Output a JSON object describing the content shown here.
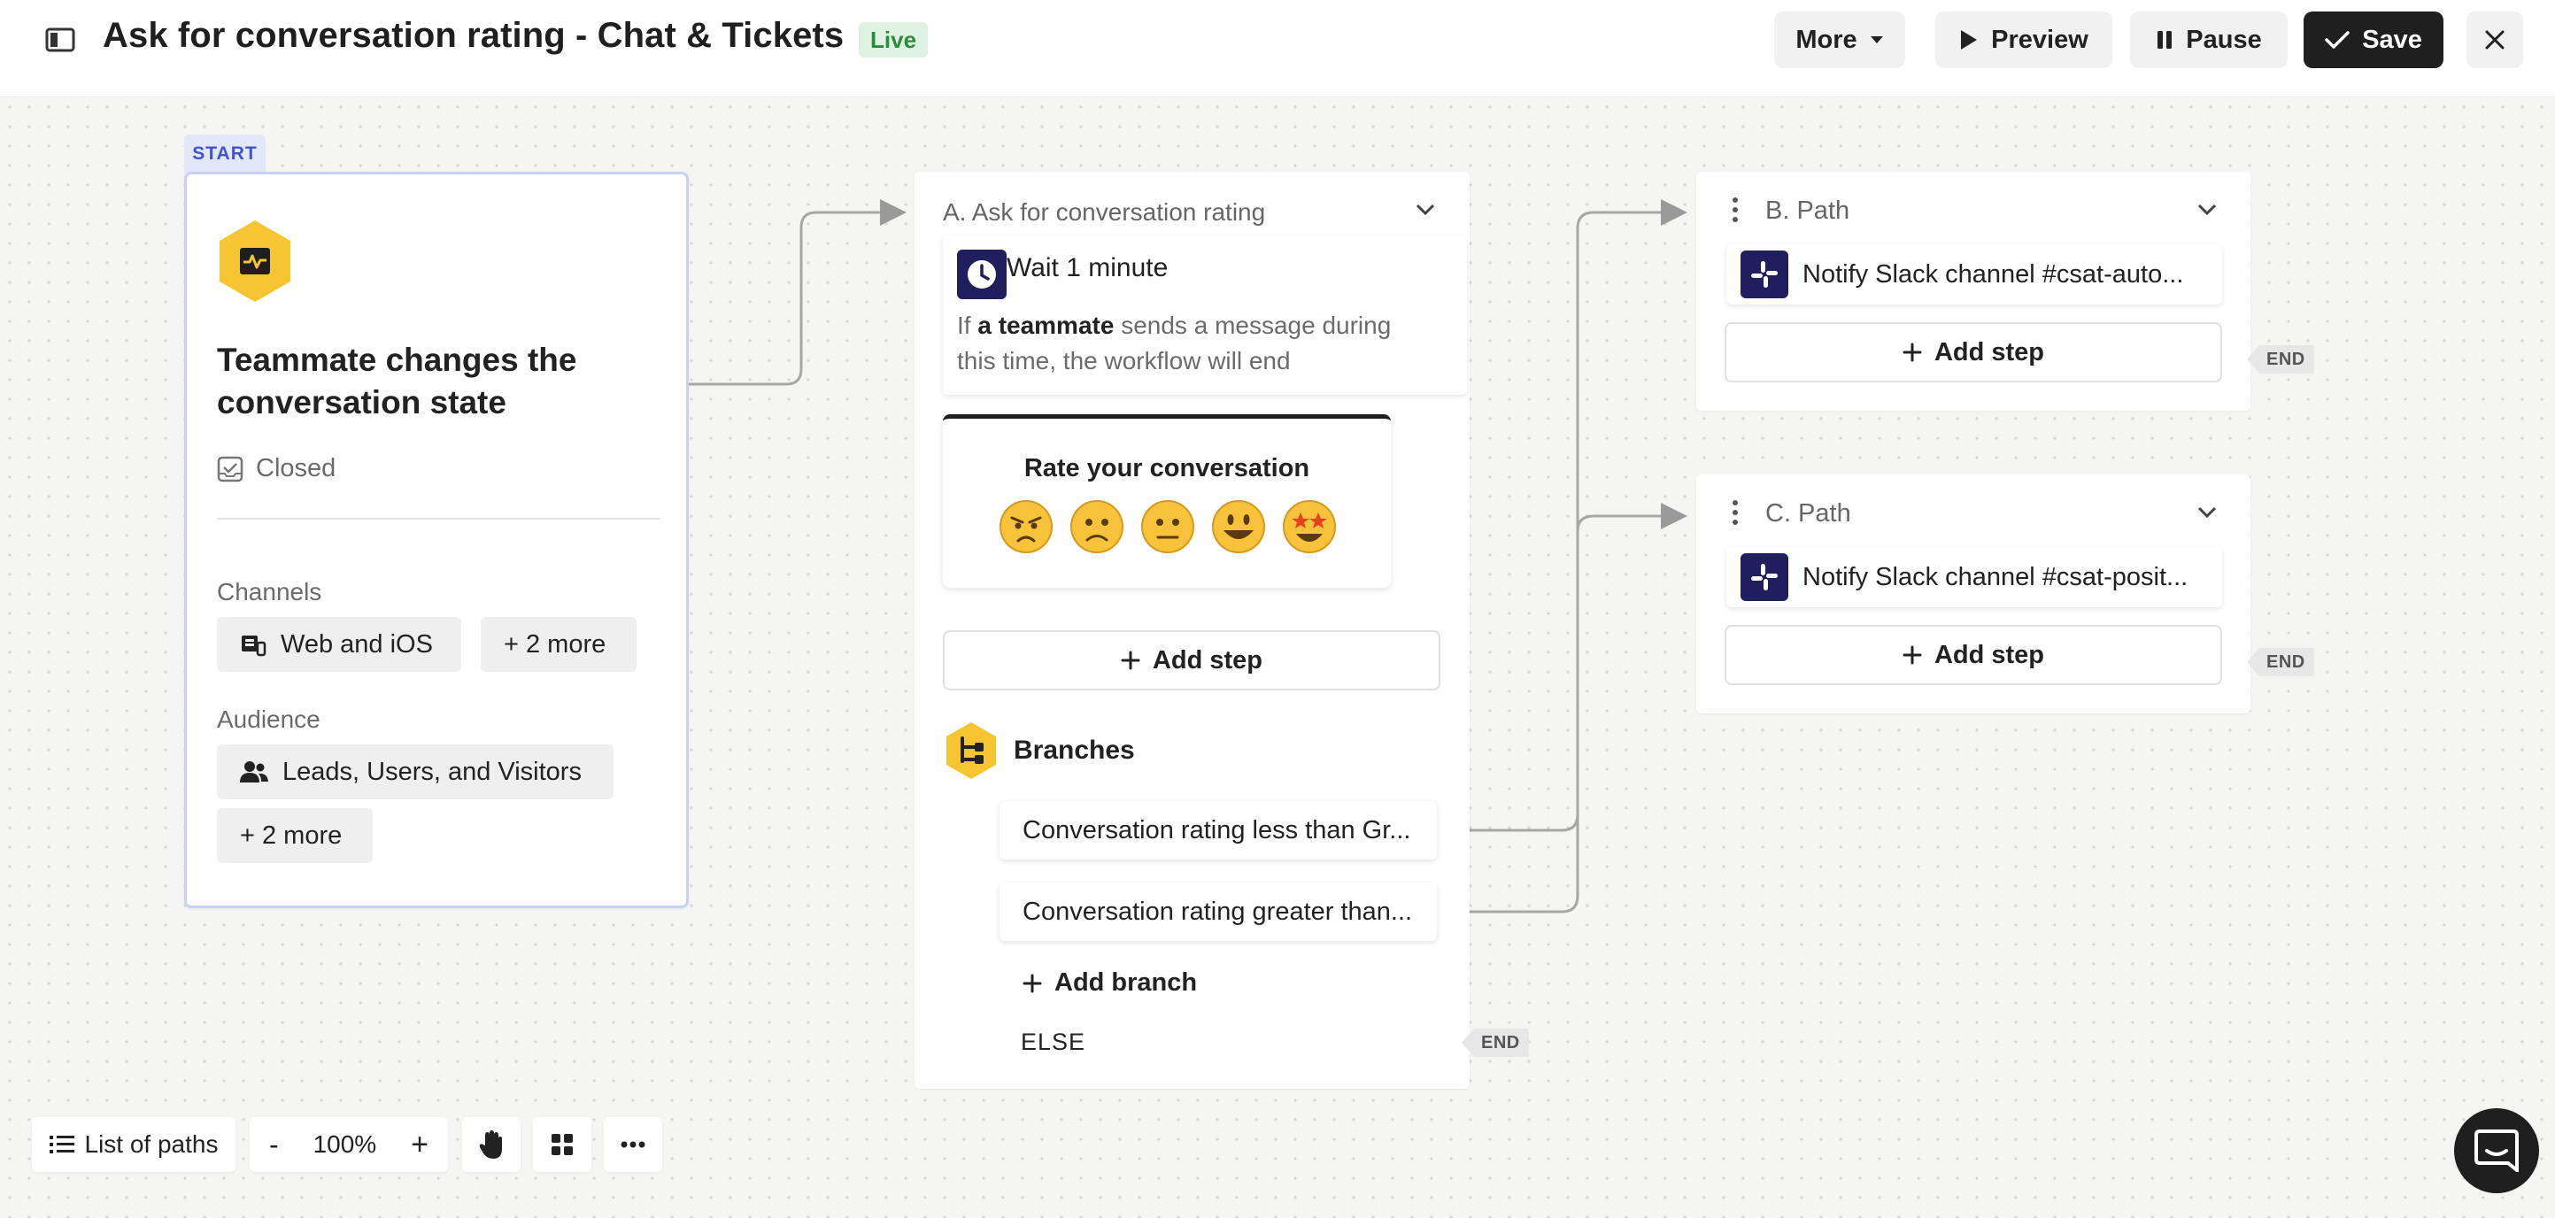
{
  "header": {
    "title": "Ask for conversation rating - Chat & Tickets",
    "status_badge": "Live",
    "more_label": "More",
    "preview_label": "Preview",
    "pause_label": "Pause",
    "save_label": "Save"
  },
  "trigger": {
    "start_tag": "START",
    "title": "Teammate changes the conversation state",
    "state": "Closed",
    "channels_label": "Channels",
    "channel_chip": "Web and iOS",
    "channel_more": "+ 2 more",
    "audience_label": "Audience",
    "audience_chip": "Leads, Users, and Visitors",
    "audience_more": "+ 2 more"
  },
  "step_a": {
    "title": "A. Ask for conversation rating",
    "wait_prefix": "Wait",
    "wait_value": "1 minute",
    "wait_desc_if": "If",
    "wait_desc_bold": "a teammate",
    "wait_desc_rest": "sends a message during this time, the workflow will end",
    "rating_title": "Rate your conversation",
    "emojis": [
      "😠",
      "🙁",
      "😐",
      "😃",
      "🤩"
    ],
    "add_step_label": "Add step",
    "branches_label": "Branches",
    "branch_1": "Conversation rating less than Gr...",
    "branch_2": "Conversation rating greater than...",
    "add_branch_label": "Add branch",
    "else_label": "ELSE",
    "end_label": "END"
  },
  "path_b": {
    "title": "B. Path",
    "action": "Notify Slack channel #csat-auto...",
    "add_step_label": "Add step",
    "end_label": "END"
  },
  "path_c": {
    "title": "C. Path",
    "action": "Notify Slack channel #csat-posit...",
    "add_step_label": "Add step",
    "end_label": "END"
  },
  "footer": {
    "list_of_paths_label": "List of paths",
    "zoom_out_label": "-",
    "zoom_level": "100%",
    "zoom_in_label": "+"
  },
  "colors": {
    "accent_dark": "#1f1f1f",
    "live_green": "#2e8a3e",
    "start_blue": "#4353c9",
    "trigger_yellow": "#f7c531",
    "slack_navy": "#1e1f5c"
  }
}
